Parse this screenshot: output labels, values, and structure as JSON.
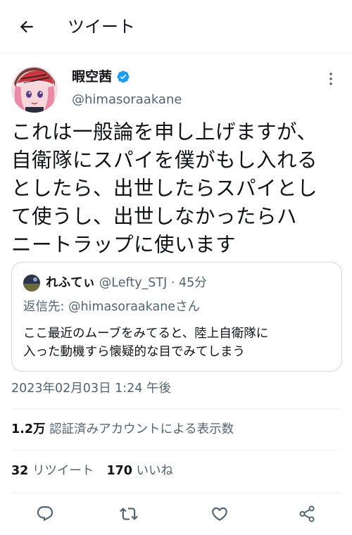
{
  "header": {
    "title": "ツイート",
    "back_icon": "arrow-left-icon"
  },
  "author": {
    "name": "暇空茜",
    "handle": "@himasoraakane",
    "verified_icon": "verified-badge-icon",
    "more_icon": "more-options-icon"
  },
  "tweet": {
    "lines": [
      "これは一般論を申し上げますが、",
      "自衛隊にスパイを僕がもし入れる",
      "としたら、出世したらスパイとし",
      "て使うし、出世しなかったらハ",
      "ニートラップに使います"
    ]
  },
  "quote": {
    "name": "れふてぃ",
    "handle": "@Lefty_STJ",
    "separator": "·",
    "time": "45分",
    "reply_prefix": "返信先: ",
    "reply_mention": "@himasoraakane",
    "reply_suffix": "さん",
    "body_lines": [
      "ここ最近のムーブをみてると、陸上自衛隊に",
      "入った動機すら懐疑的な目でみてしまう"
    ]
  },
  "timestamp": "2023年02月03日 1:24 午後",
  "views": {
    "count": "1.2万",
    "label": "認証済みアカウントによる表示数"
  },
  "stats": {
    "retweets_count": "32",
    "retweets_label": "リツイート",
    "likes_count": "170",
    "likes_label": "いいね"
  },
  "actions": [
    {
      "icon": "reply-icon"
    },
    {
      "icon": "retweet-icon"
    },
    {
      "icon": "like-icon"
    },
    {
      "icon": "share-icon"
    }
  ],
  "colors": {
    "text": "#0f1419",
    "muted": "#536471",
    "verified": "#1d9bf0",
    "border": "#cfd9de",
    "divider": "#eff3f4"
  }
}
